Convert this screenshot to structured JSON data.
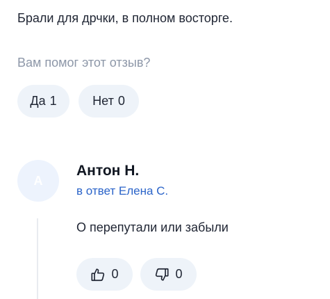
{
  "review": {
    "text": "Брали для дрчки, в полном восторге.",
    "helpful_question": "Вам помог этот отзыв?",
    "yes_label": "Да",
    "yes_count": "1",
    "no_label": "Нет",
    "no_count": "0"
  },
  "reply": {
    "avatar_letter": "А",
    "author": "Антон Н.",
    "in_reply_to": "в ответ Елена С.",
    "text": "О перепутали или забыли",
    "likes": "0",
    "dislikes": "0"
  }
}
